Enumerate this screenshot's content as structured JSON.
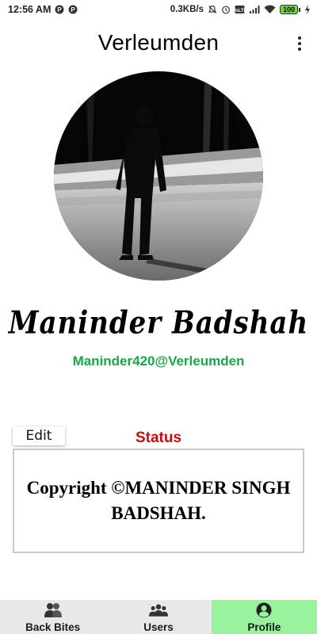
{
  "status_bar": {
    "time": "12:56 AM",
    "notification_icons": [
      "p-icon",
      "p-icon"
    ],
    "network_speed": "0.3KB/s",
    "battery_level": "100",
    "battery_color": "#6ed34a"
  },
  "app_bar": {
    "title": "Verleumden"
  },
  "profile": {
    "name": "Maninder Badshah",
    "username": "Maninder420@Verleumden",
    "username_color": "#1aa64a"
  },
  "status_section": {
    "edit_label": "Edit",
    "title": "Status",
    "title_color": "#c40e0e",
    "text": "Copyright ©MANINDER SINGH BADSHAH."
  },
  "bottom_nav": {
    "tabs": [
      {
        "label": "Back Bites",
        "icon": "back-bites-icon",
        "active": false
      },
      {
        "label": "Users",
        "icon": "users-icon",
        "active": false
      },
      {
        "label": "Profile",
        "icon": "profile-icon",
        "active": true
      }
    ],
    "active_color": "#98f29b",
    "bar_color": "#e8e8e8"
  }
}
